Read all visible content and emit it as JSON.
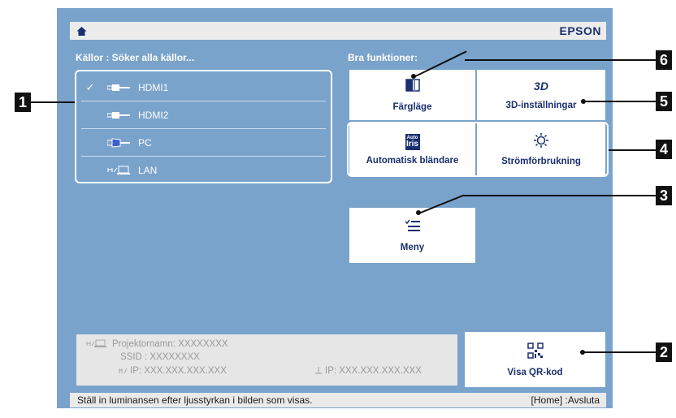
{
  "header": {
    "brand": "EPSON"
  },
  "sources": {
    "heading": "Källor : Söker alla källor...",
    "items": [
      {
        "label": "HDMI1",
        "selected": true,
        "check": "✓",
        "icon": "hdmi-icon"
      },
      {
        "label": "HDMI2",
        "selected": false,
        "icon": "hdmi-icon"
      },
      {
        "label": "PC",
        "selected": false,
        "icon": "vga-connector-icon"
      },
      {
        "label": "LAN",
        "selected": false,
        "icon": "network-computer-icon"
      }
    ]
  },
  "features": {
    "heading": "Bra funktioner:",
    "color_mode": "Färgläge",
    "settings_3d": "3D-inställningar",
    "auto_iris": "Automatisk bländare",
    "auto_iris_icon_text": {
      "top": "Auto",
      "bottom": "Iris"
    },
    "power": "Strömförbrukning",
    "menu": "Meny",
    "icon_3d_text": "3D"
  },
  "network_info": {
    "projector_name": "Projektornamn:  XXXXXXXX",
    "ssid": "SSID :  XXXXXXXX",
    "wireless_ip": "IP:  XXX.XXX.XXX.XXX",
    "wired_ip": "IP:  XXX.XXX.XXX.XXX"
  },
  "qr": {
    "label": "Visa QR-kod"
  },
  "status": {
    "hint": "Ställ in luminansen efter ljusstyrkan i bilden som visas.",
    "exit": "[Home] :Avsluta"
  },
  "callouts": [
    "1",
    "2",
    "3",
    "4",
    "5",
    "6"
  ],
  "colors": {
    "screen_bg": "#7aa3cc",
    "accent_text": "#1a2f6e",
    "callout": "#111111"
  }
}
